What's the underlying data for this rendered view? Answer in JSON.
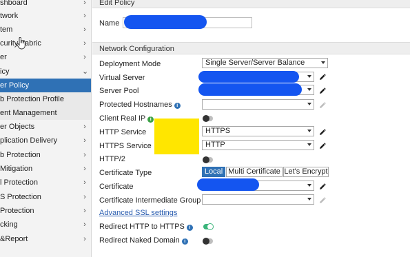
{
  "sidebar": {
    "items": [
      {
        "label": "shboard",
        "chevron": "›"
      },
      {
        "label": "twork",
        "chevron": "›"
      },
      {
        "label": "tem",
        "chevron": "›"
      },
      {
        "label": "curity Fabric",
        "chevron": "›"
      },
      {
        "label": "er",
        "chevron": "›"
      },
      {
        "label": "icy",
        "chevron": "⌄"
      },
      {
        "label": "er Policy",
        "chevron": ""
      },
      {
        "label": "b Protection Profile",
        "chevron": ""
      },
      {
        "label": "ent Management",
        "chevron": ""
      },
      {
        "label": "er Objects",
        "chevron": "›"
      },
      {
        "label": "plication Delivery",
        "chevron": "›"
      },
      {
        "label": "b Protection",
        "chevron": "›"
      },
      {
        "label": "Mitigation",
        "chevron": "›"
      },
      {
        "label": "l Protection",
        "chevron": "›"
      },
      {
        "label": "S Protection",
        "chevron": "›"
      },
      {
        "label": "Protection",
        "chevron": "›"
      },
      {
        "label": "cking",
        "chevron": "›"
      },
      {
        "label": "&Report",
        "chevron": "›"
      }
    ]
  },
  "form": {
    "edit_policy_title": "Edit Policy",
    "name_label": "Name",
    "network_config_title": "Network Configuration",
    "deployment_mode_label": "Deployment Mode",
    "deployment_mode_value": "Single Server/Server Balance",
    "virtual_server_label": "Virtual Server",
    "server_pool_label": "Server Pool",
    "protected_hostnames_label": "Protected Hostnames",
    "client_real_ip_label": "Client Real IP",
    "http_service_label": "HTTP Service",
    "http_service_value": "HTTPS",
    "https_service_label": "HTTPS Service",
    "https_service_value": "HTTP",
    "http2_label": "HTTP/2",
    "certificate_type_label": "Certificate Type",
    "cert_type_options": [
      "Local",
      "Multi Certificate",
      "Let's Encrypt"
    ],
    "certificate_label": "Certificate",
    "cert_intermediate_label": "Certificate Intermediate Group",
    "advanced_ssl_link": "Advanced SSL settings",
    "redirect_http_label": "Redirect HTTP to HTTPS",
    "redirect_naked_label": "Redirect Naked Domain"
  },
  "toggles": {
    "client_real_ip": false,
    "http2": false,
    "redirect_http_to_https": true,
    "redirect_naked_domain": false
  },
  "colors": {
    "accent": "#2f71b5",
    "redaction": "#1455f0",
    "highlight": "#ffe600",
    "toggle_on": "#3ab47a"
  }
}
